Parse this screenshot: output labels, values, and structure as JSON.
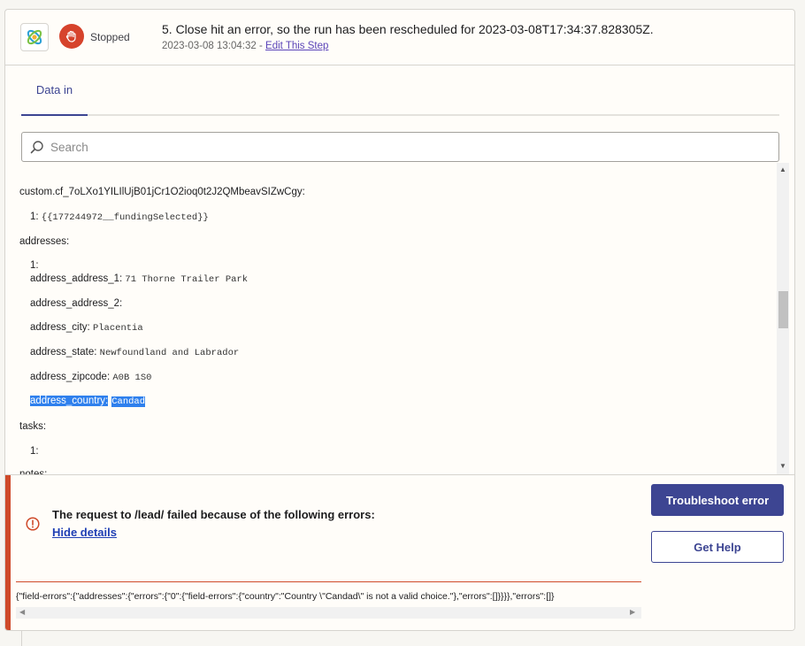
{
  "header": {
    "status": "Stopped",
    "title": "5. Close hit an error, so the run has been rescheduled for 2023-03-08T17:34:37.828305Z.",
    "timestamp": "2023-03-08 13:04:32",
    "separator": " - ",
    "edit_link": "Edit This Step"
  },
  "tabs": [
    {
      "label": "Data in",
      "active": true
    }
  ],
  "search": {
    "placeholder": "Search",
    "value": ""
  },
  "tree": [
    {
      "key": "custom.cf_7oLXo1YILIlUjB01jCr1O2ioq0t2J2QMbeavSIZwCgy:",
      "value": ""
    },
    {
      "key": "1: ",
      "value": "{{177244972__fundingSelected}}"
    },
    {
      "key": "addresses:",
      "value": ""
    },
    {
      "key": "1:",
      "value": ""
    },
    {
      "key": "address_address_1: ",
      "value": "71 Thorne Trailer Park"
    },
    {
      "key": "address_address_2:",
      "value": ""
    },
    {
      "key": "address_city: ",
      "value": "Placentia"
    },
    {
      "key": "address_state: ",
      "value": "Newfoundland and Labrador"
    },
    {
      "key": "address_zipcode: ",
      "value": "A0B 1S0"
    },
    {
      "key": "address_country:",
      "value": "Candad"
    },
    {
      "key": "tasks:",
      "value": ""
    },
    {
      "key": "1:",
      "value": ""
    },
    {
      "key": "notes:",
      "value": ""
    }
  ],
  "error": {
    "message": "The request to /lead/ failed because of the following errors:",
    "toggle_link": "Hide details",
    "raw": "{\"field-errors\":{\"addresses\":{\"errors\":{\"0\":{\"field-errors\":{\"country\":\"Country \\\"Candad\\\" is not a valid choice.\"},\"errors\":[]}}}},\"errors\":[]}",
    "primary_button": "Troubleshoot error",
    "secondary_button": "Get Help"
  },
  "colors": {
    "accent": "#3d4592",
    "error": "#cf4a2a",
    "stop": "#d6432c",
    "link": "#1f3fb4",
    "highlight": "#2f80ed"
  },
  "icons": [
    "app-logo-icon",
    "stop-hand-icon",
    "search-icon",
    "error-info-icon",
    "scroll-up-icon",
    "scroll-down-icon",
    "scroll-left-icon",
    "scroll-right-icon"
  ]
}
